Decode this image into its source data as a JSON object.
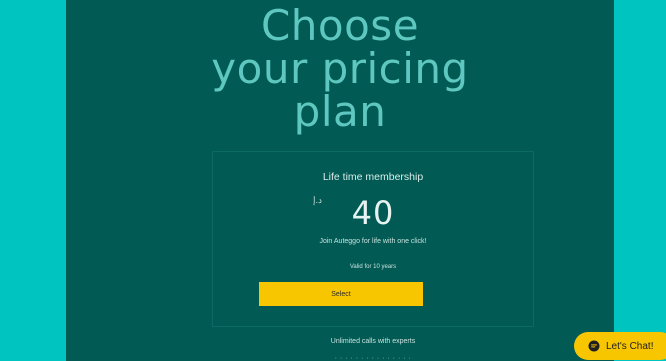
{
  "page": {
    "heading_lines": [
      "Choose",
      "your pricing",
      "plan"
    ]
  },
  "plan": {
    "title": "Life time membership",
    "currency": "د.إ",
    "price": "40",
    "tagline": "Join Auteggo for life with one click!",
    "validity": "Valid for 10 years",
    "select_label": "Select",
    "features": [
      "Unlimited calls with experts",
      "· · · · · · · · · · · · · · ·"
    ]
  },
  "chat": {
    "label": "Let's Chat!",
    "icon": "chat-bubble-icon"
  },
  "colors": {
    "background_band": "#00c4c0",
    "panel": "#025a54",
    "heading": "#5ec7bf",
    "accent": "#f7c600"
  }
}
